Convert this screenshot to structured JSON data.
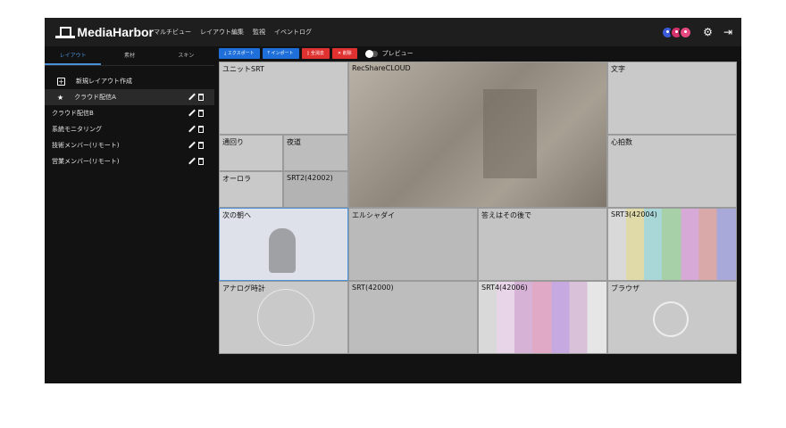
{
  "app": {
    "name": "MediaHarbor"
  },
  "nav": [
    "マルチビュー",
    "レイアウト編集",
    "監視",
    "イベントログ"
  ],
  "icons": {
    "settings": "gear-icon",
    "logout": "logout-icon",
    "logo": "ship-logo-icon"
  },
  "sidebar": {
    "tabs": [
      "レイアウト",
      "素材",
      "スキン"
    ],
    "new_label": "新規レイアウト作成",
    "items": [
      {
        "label": "クラウド配信A",
        "selected": true
      },
      {
        "label": "クラウド配信B"
      },
      {
        "label": "系統モニタリング"
      },
      {
        "label": "技術メンバー(リモート)"
      },
      {
        "label": "営業メンバー(リモート)"
      }
    ]
  },
  "toolbar": {
    "export_label": "エクスポート",
    "import_label": "インポート",
    "select_all_label": "全消去",
    "delete_label": "削除",
    "preview_label": "プレビュー"
  },
  "cells": [
    {
      "label": "ユニットSRT"
    },
    {
      "label": "RecShareCLOUD"
    },
    {
      "label": "文字"
    },
    {
      "label": "通回り"
    },
    {
      "label": "夜道"
    },
    {
      "label": "心拍数"
    },
    {
      "label": "オーロラ"
    },
    {
      "label": "SRT2(42002)"
    },
    {
      "label": "次の朝へ"
    },
    {
      "label": "エルシャダイ"
    },
    {
      "label": "答えはその後で"
    },
    {
      "label": "SRT3(42004)"
    },
    {
      "label": "アナログ時計"
    },
    {
      "label": "SRT(42000)"
    },
    {
      "label": "SRT4(42006)"
    },
    {
      "label": "ブラウザ"
    }
  ],
  "colors": {
    "accent": "#1e6fd9",
    "danger": "#e03131",
    "tab_active": "#4a90d9"
  }
}
